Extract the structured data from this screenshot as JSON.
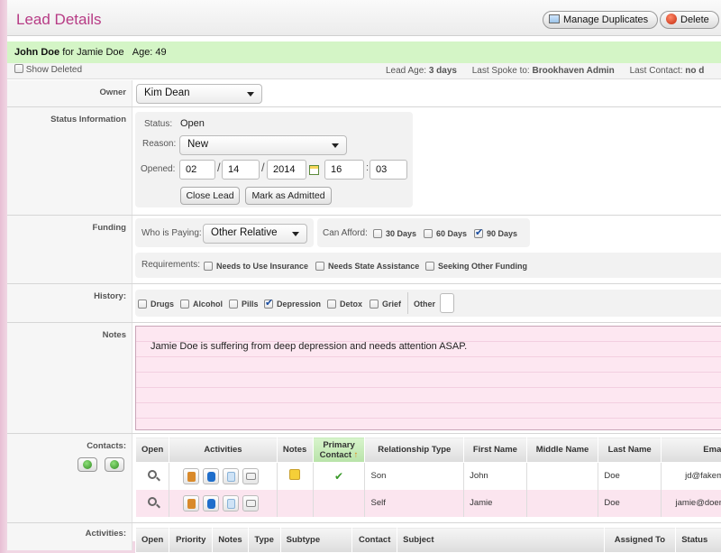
{
  "header": {
    "title": "Lead Details",
    "manage_duplicates": "Manage Duplicates",
    "delete": "Delete"
  },
  "lead": {
    "name": "John Doe",
    "for_text": "for Jamie Doe",
    "age_text": "Age: 49"
  },
  "infobar": {
    "show_deleted": "Show Deleted",
    "lead_age_label": "Lead Age:",
    "lead_age_value": "3 days",
    "last_spoke_label": "Last Spoke to:",
    "last_spoke_value": "Brookhaven Admin",
    "last_contact_label": "Last Contact:",
    "last_contact_value": "no d"
  },
  "owner": {
    "label": "Owner",
    "value": "Kim Dean"
  },
  "status": {
    "label": "Status Information",
    "status_label": "Status:",
    "status_value": "Open",
    "reason_label": "Reason:",
    "reason_value": "New",
    "opened_label": "Opened:",
    "month": "02",
    "day": "14",
    "year": "2014",
    "hour": "16",
    "minute": "03",
    "close_lead": "Close Lead",
    "mark_admitted": "Mark as Admitted"
  },
  "funding": {
    "label": "Funding",
    "who_paying_label": "Who is Paying:",
    "who_paying_value": "Other Relative",
    "can_afford_label": "Can Afford:",
    "opt_30": "30 Days",
    "opt_60": "60 Days",
    "opt_90": "90 Days",
    "requirements_label": "Requirements:",
    "req_insurance": "Needs to Use Insurance",
    "req_state": "Needs State Assistance",
    "req_other": "Seeking Other Funding"
  },
  "history": {
    "label": "History:",
    "items": [
      "Drugs",
      "Alcohol",
      "Pills",
      "Depression",
      "Detox",
      "Grief"
    ],
    "other_label": "Other"
  },
  "notes": {
    "label": "Notes",
    "text": "Jamie Doe is suffering from deep depression and needs attention ASAP."
  },
  "contacts": {
    "label": "Contacts:",
    "columns": [
      "Open",
      "Activities",
      "Notes",
      "Primary Contact",
      "Relationship Type",
      "First Name",
      "Middle Name",
      "Last Name",
      "Emai"
    ],
    "rows": [
      {
        "relationship": "Son",
        "first": "John",
        "middle": "",
        "last": "Doe",
        "email": "jd@fakem"
      },
      {
        "relationship": "Self",
        "first": "Jamie",
        "middle": "",
        "last": "Doe",
        "email": "jamie@doen"
      }
    ]
  },
  "activities": {
    "label": "Activities:",
    "columns": [
      "Open",
      "Priority",
      "Notes",
      "Type",
      "Subtype",
      "Contact",
      "Subject",
      "Assigned To",
      "Status"
    ]
  },
  "colors": {
    "accent": "#b73b85",
    "header_green": "#d4f5c6",
    "notes_pink": "#fde7f1"
  }
}
